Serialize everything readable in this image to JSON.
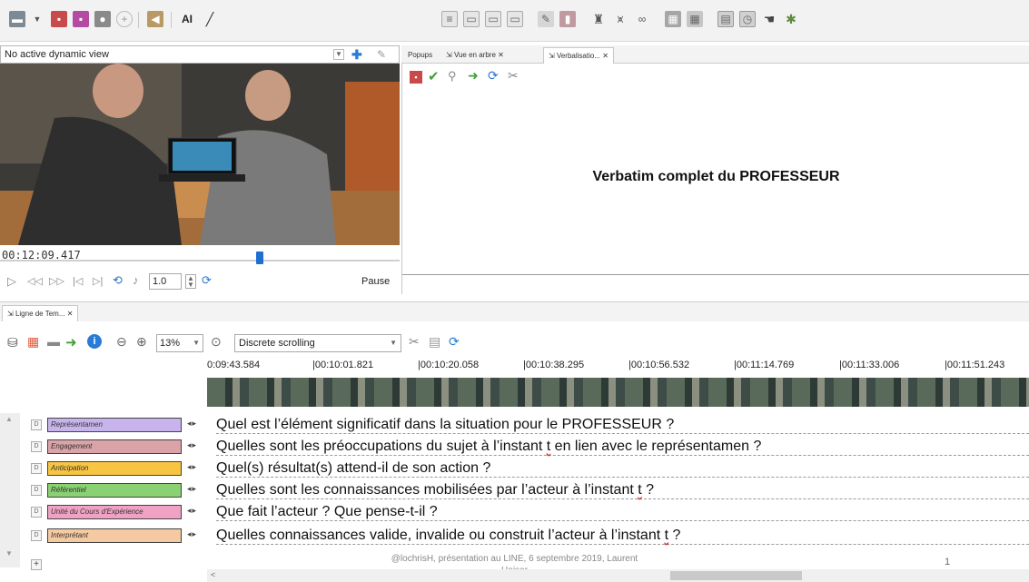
{
  "toolbar": {
    "text_tool": "AI",
    "icons": [
      "folder-icon",
      "chevron-down-icon",
      "save-icon",
      "save-as-icon",
      "camera-icon",
      "circle-icon",
      "undo-icon",
      "text-icon",
      "pencil-icon",
      "layout-icon",
      "window-icon",
      "window-icon",
      "window-icon",
      "edit-icon",
      "book-icon",
      "person-icon",
      "graph-icon",
      "binocular-icon",
      "grid-icon",
      "grid-icon",
      "table-icon",
      "clock-icon",
      "hand-icon",
      "extensions-icon"
    ]
  },
  "video_panel": {
    "dynamic_view": "No active dynamic view",
    "timecode": "00:12:09.417",
    "rate": "1.0",
    "status": "Pause",
    "progress": 0.65
  },
  "tabs": [
    "Popups",
    "Vue en arbre",
    "Verbalisatio..."
  ],
  "notes": {
    "verbatim": "Verbatim complet du PROFESSEUR"
  },
  "timeline": {
    "tab": "Ligne de Tem...",
    "zoom": "13%",
    "scrolling": "Discrete scrolling",
    "ruler": [
      "0:09:43.584",
      "|00:10:01.821",
      "|00:10:20.058",
      "|00:10:38.295",
      "|00:10:56.532",
      "|00:11:14.769",
      "|00:11:33.006",
      "|00:11:51.243"
    ],
    "tracks": [
      {
        "label": "Représentamen",
        "color": "#c8b4ec",
        "question": "Quel est l’élément significatif dans la situation pour le PROFESSEUR ?"
      },
      {
        "label": "Engagement",
        "color": "#d9a3a8",
        "question": "Quelles sont les préoccupations du sujet à l’instant t en lien avec le représentamen ?"
      },
      {
        "label": "Anticipation",
        "color": "#f7c542",
        "question": "Quel(s) résultat(s) attend-il de son action ?"
      },
      {
        "label": "Référentiel",
        "color": "#8ad173",
        "question": "Quelles sont les connaissances mobilisées par l’acteur à l’instant t ?"
      },
      {
        "label": "Unité du Cours d'Expérience",
        "color": "#f0a2c4",
        "question": "Que fait l’acteur ? Que pense-t-il ?"
      },
      {
        "label": "Interprétant",
        "color": "#f5c9a2",
        "question": "Quelles connaissances valide, invalide ou construit l’acteur à l’instant t ?"
      }
    ]
  },
  "footer": {
    "credit_line1": "@lochrisH, présentation au LINE, 6 septembre 2019, Laurent",
    "credit_line2": "Heiser",
    "page": "1"
  }
}
